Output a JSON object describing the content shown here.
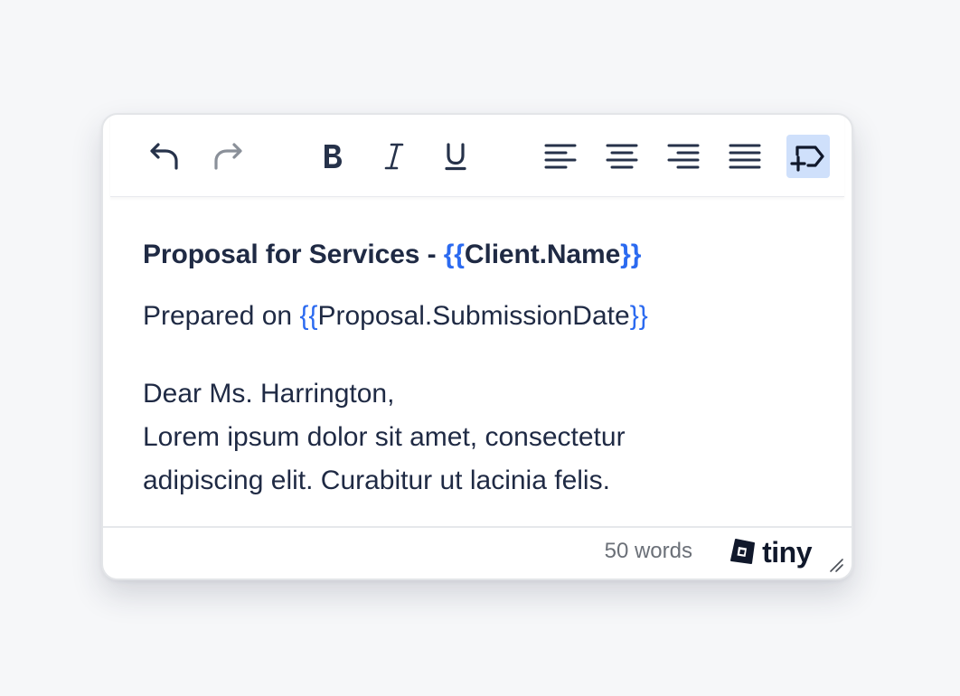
{
  "toolbar": {
    "buttons": [
      {
        "name": "undo",
        "icon": "undo-icon"
      },
      {
        "name": "redo",
        "icon": "redo-icon"
      },
      {
        "name": "bold",
        "icon": "bold-icon"
      },
      {
        "name": "italic",
        "icon": "italic-icon"
      },
      {
        "name": "underline",
        "icon": "underline-icon"
      },
      {
        "name": "align-left",
        "icon": "align-left-icon"
      },
      {
        "name": "align-center",
        "icon": "align-center-icon"
      },
      {
        "name": "align-right",
        "icon": "align-right-icon"
      },
      {
        "name": "align-justify",
        "icon": "align-justify-icon"
      },
      {
        "name": "insert-merge-tag",
        "icon": "merge-tag-icon",
        "active": true
      }
    ]
  },
  "document": {
    "heading_prefix": "Proposal for Services - ",
    "heading_tag_open": "{{",
    "heading_tag": "Client.Name",
    "heading_tag_close": "}}",
    "subline_prefix": "Prepared on ",
    "subline_tag_open": "{{",
    "subline_tag": "Proposal.SubmissionDate",
    "subline_tag_close": "}}",
    "greeting": "Dear Ms. Harrington,",
    "body": "Lorem ipsum dolor sit amet, consectetur adipiscing elit. Curabitur ut lacinia felis."
  },
  "statusbar": {
    "word_count": "50 words",
    "brand": "tiny"
  },
  "colors": {
    "merge_tag": "#2b6af0",
    "text": "#1f2a44",
    "active_button_bg": "#cfe0fb",
    "redo_disabled": "#8a9099"
  }
}
